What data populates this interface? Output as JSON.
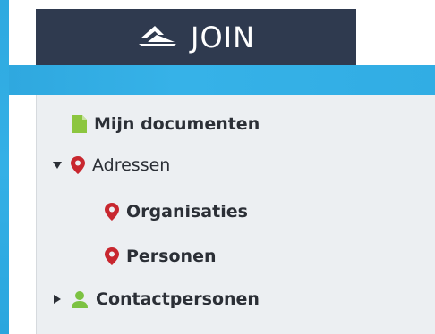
{
  "brand": {
    "name": "JOIN",
    "logo_icon": "join-logo-icon"
  },
  "colors": {
    "header_bg": "#2f3a4f",
    "accent_blue": "#31ade4",
    "panel_bg": "#eceff2",
    "pin_red": "#c8272f",
    "doc_green": "#8cc63f",
    "person_green": "#7cc242"
  },
  "menu": {
    "items": [
      {
        "label": "Mijn documenten",
        "icon": "document-icon"
      },
      {
        "label": "Adressen",
        "icon": "map-pin-icon",
        "expanded": true,
        "caret": "caret-down-icon"
      },
      {
        "label": "Organisaties",
        "icon": "map-pin-icon"
      },
      {
        "label": "Personen",
        "icon": "map-pin-icon"
      },
      {
        "label": "Contactpersonen",
        "icon": "person-icon",
        "expanded": false,
        "caret": "caret-right-icon"
      }
    ]
  }
}
